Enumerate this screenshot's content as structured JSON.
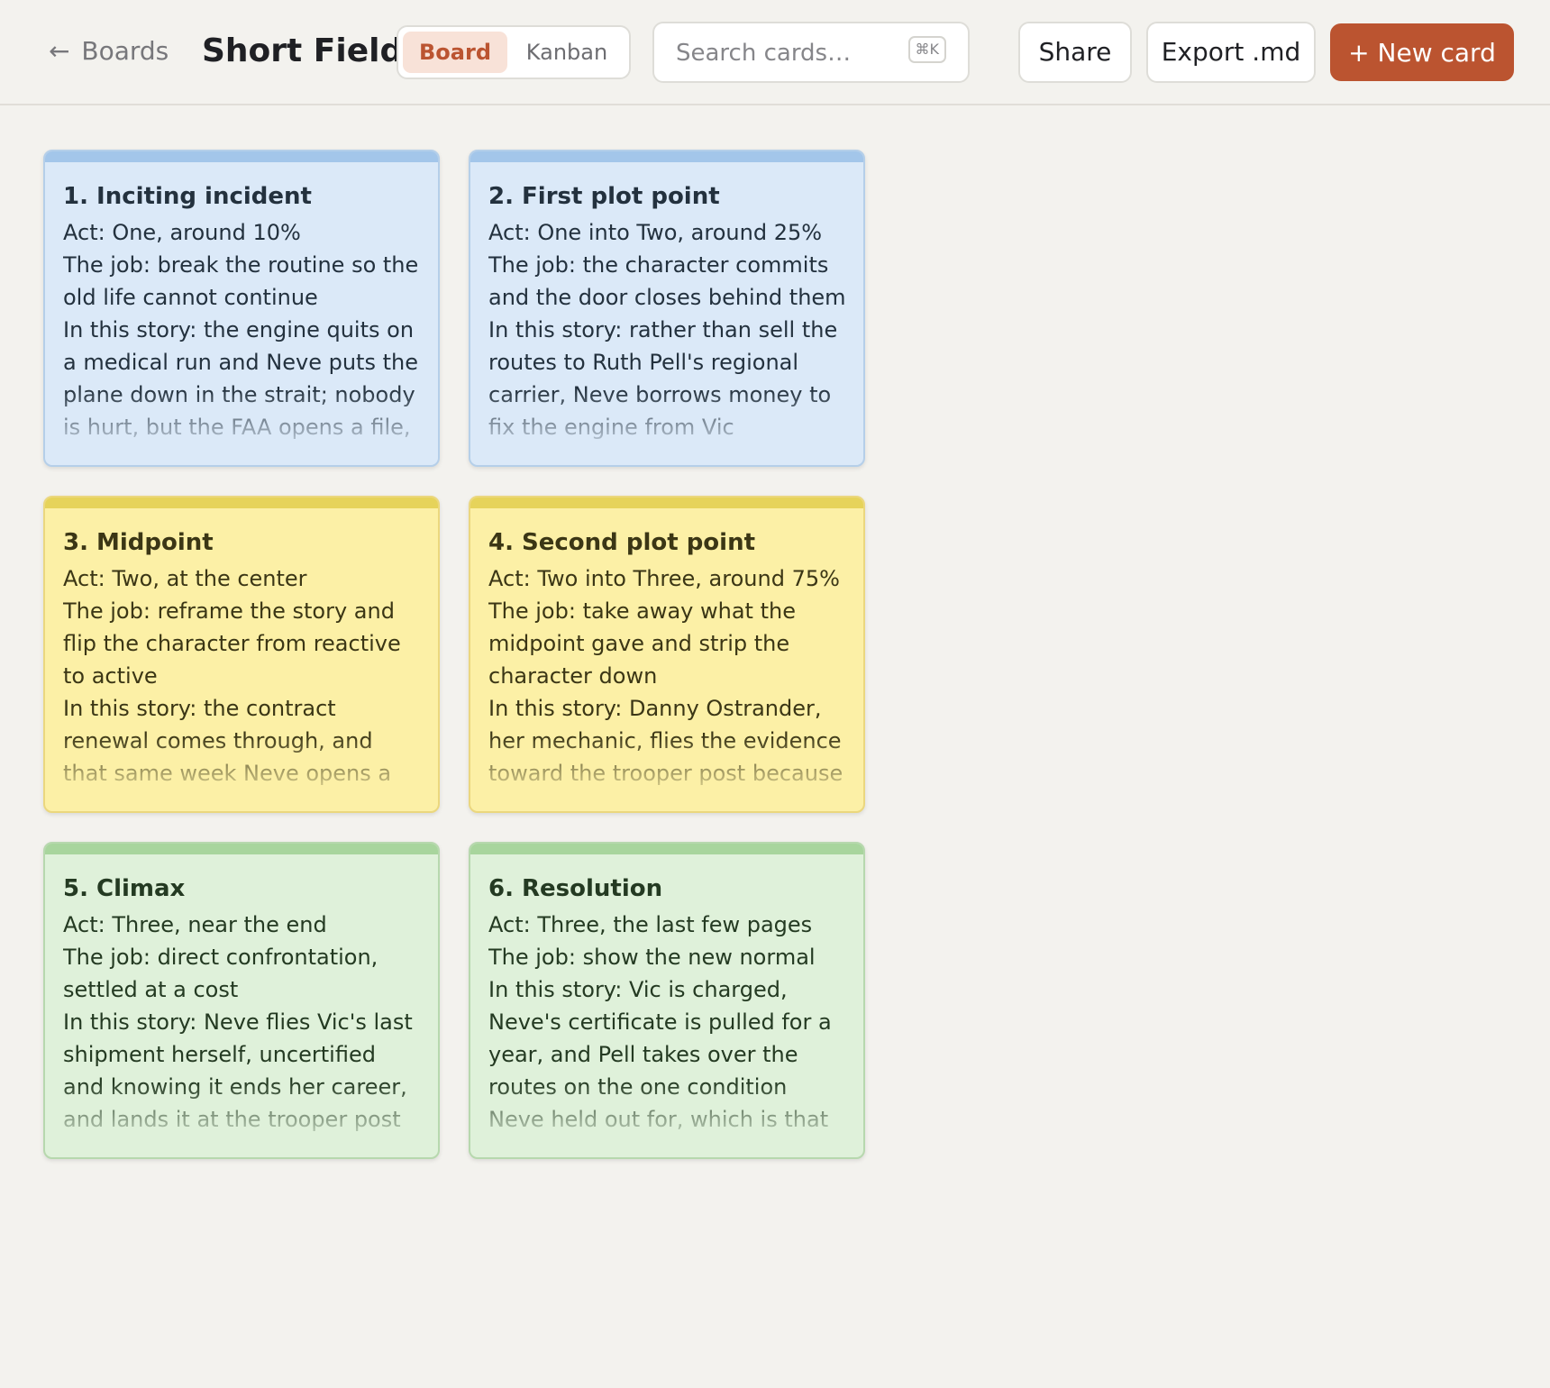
{
  "header": {
    "back_arrow": "←",
    "back_label": "Boards",
    "title": "Short Field",
    "view_toggle": {
      "active": "Board",
      "inactive": "Kanban"
    },
    "search": {
      "placeholder": "Search cards…",
      "value": "",
      "shortcut": "⌘K"
    },
    "share_label": "Share",
    "export_label": "Export .md",
    "new_card_label": "+ New card"
  },
  "colors": {
    "accent": "#bb5430",
    "blue_card": "#dbe9f8",
    "yellow_card": "#fcf0a6",
    "green_card": "#dff1da"
  },
  "cards": [
    {
      "title": "1. Inciting incident",
      "act": "Act: One, around 10%",
      "job": "The job: break the routine so the old life cannot continue",
      "story": "In this story: the engine quits on a medical run and Neve puts the plane down in the strait; nobody is hurt, but the FAA opens a file, and"
    },
    {
      "title": "2. First plot point",
      "act": "Act: One into Two, around 25%",
      "job": "The job: the character commits and the door closes behind them",
      "story": "In this story: rather than sell the routes to Ruth Pell's regional carrier, Neve borrows money to fix the engine from Vic Sandoval, who"
    },
    {
      "title": "3. Midpoint",
      "act": "Act: Two, at the center",
      "job": "The job: reframe the story and flip the character from reactive to active",
      "story": "In this story: the contract renewal comes through, and that same week Neve opens a crate and finds"
    },
    {
      "title": "4. Second plot point",
      "act": "Act: Two into Three, around 75%",
      "job": "The job: take away what the midpoint gave and strip the character down",
      "story": "In this story: Danny Ostrander, her mechanic, flies the evidence toward the trooper post because"
    },
    {
      "title": "5. Climax",
      "act": "Act: Three, near the end",
      "job": "The job: direct confrontation, settled at a cost",
      "story": "In this story: Neve flies Vic's last shipment herself, uncertified and knowing it ends her career, and lands it at the trooper post instead"
    },
    {
      "title": "6. Resolution",
      "act": "Act: Three, the last few pages",
      "job": "The job: show the new normal",
      "story": "In this story: Vic is charged, Neve's certificate is pulled for a year, and Pell takes over the routes on the one condition Neve held out for, which is that all six villages stay"
    }
  ]
}
